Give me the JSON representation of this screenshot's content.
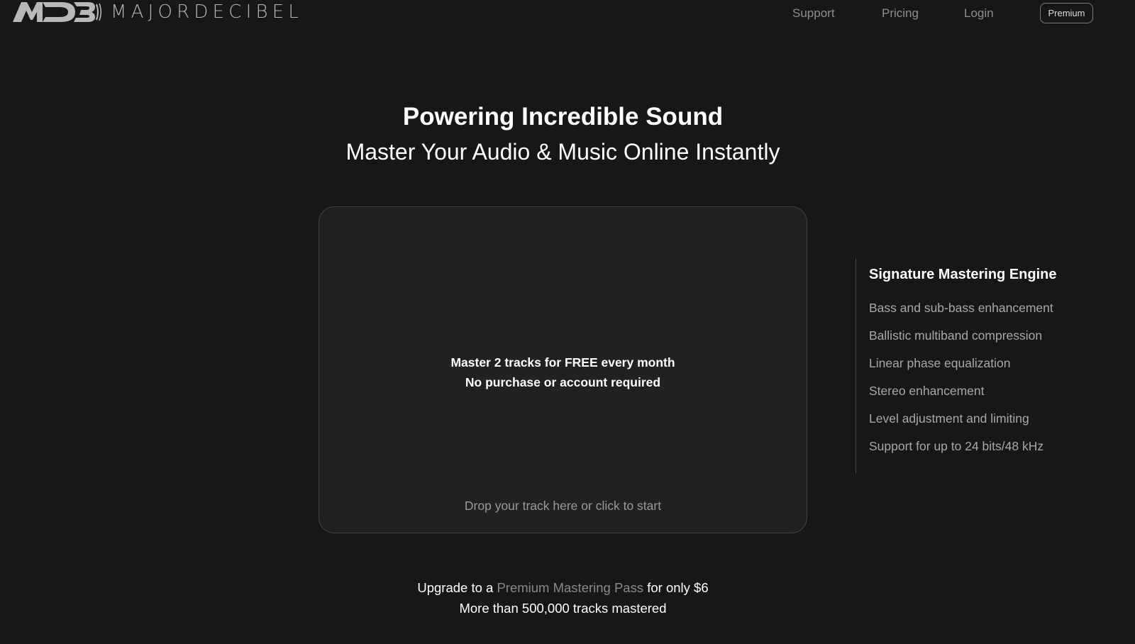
{
  "brand": {
    "logo_mark": "MDB",
    "wordmark": "MAJORDECIBEL"
  },
  "nav": {
    "support": "Support",
    "pricing": "Pricing",
    "login": "Login",
    "premium": "Premium"
  },
  "hero": {
    "title": "Powering Incredible Sound",
    "subtitle": "Master Your Audio & Music Online Instantly"
  },
  "dropzone": {
    "line1": "Master 2 tracks for FREE every month",
    "line2": "No purchase or account required",
    "hint": "Drop your track here or click to start"
  },
  "features": {
    "title": "Signature Mastering Engine",
    "items": [
      "Bass and sub-bass enhancement",
      "Ballistic multiband compression",
      "Linear phase equalization",
      "Stereo enhancement",
      "Level adjustment and limiting",
      "Support for up to 24 bits/48 kHz"
    ]
  },
  "footer": {
    "upgrade_prefix": "Upgrade to a ",
    "upgrade_link": "Premium Mastering Pass",
    "upgrade_suffix": " for only $6",
    "stats": "More than 500,000 tracks mastered"
  },
  "colors": {
    "background": "#171717",
    "card": "#212121",
    "muted_text": "#a8a8a8",
    "link_text": "#8a8a8a"
  }
}
